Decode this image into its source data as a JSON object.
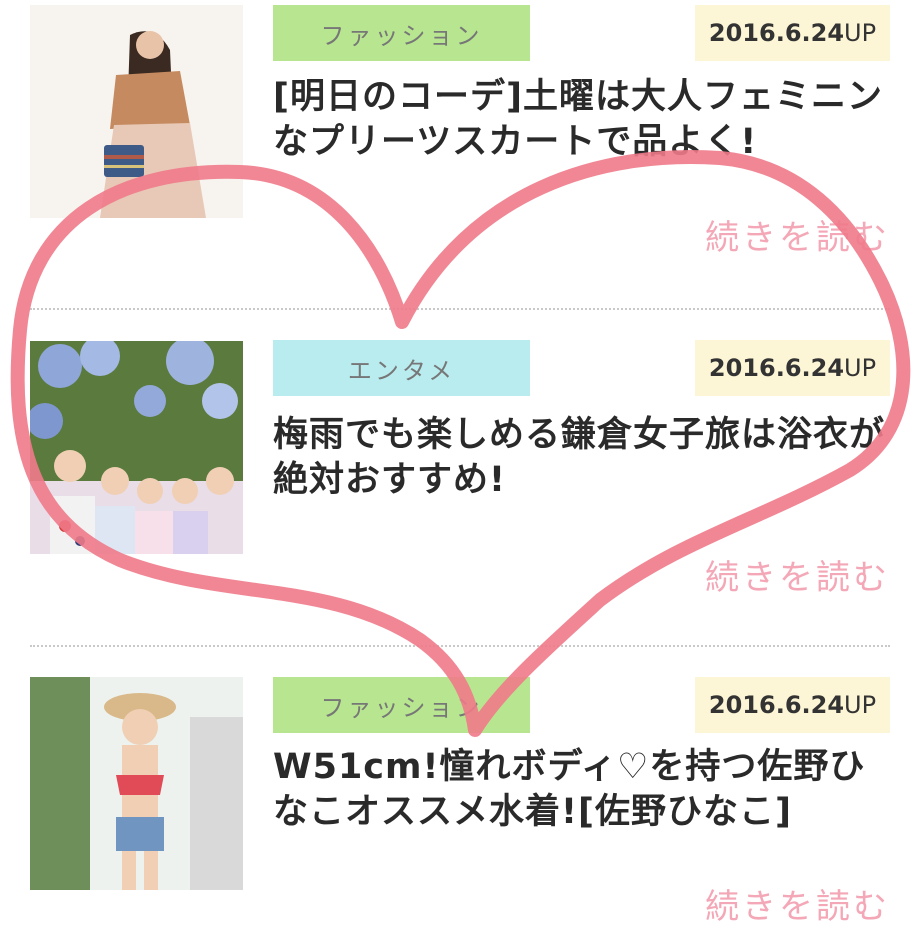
{
  "articles": [
    {
      "category": "ファッション",
      "category_color": "#b8e690",
      "date": "2016.6.24",
      "date_suffix": "UP",
      "title": "[明日のコーデ]土曜は大人フェミニンなプリーツスカートで品よく!",
      "read_more": "続きを読む"
    },
    {
      "category": "エンタメ",
      "category_color": "#b8ecef",
      "date": "2016.6.24",
      "date_suffix": "UP",
      "title": "梅雨でも楽しめる鎌倉女子旅は浴衣が絶対おすすめ!",
      "read_more": "続きを読む"
    },
    {
      "category": "ファッション",
      "category_color": "#b8e690",
      "date": "2016.6.24",
      "date_suffix": "UP",
      "title": "W51cm!憧れボディ♡を持つ佐野ひなこオススメ水着![佐野ひなこ]",
      "read_more": "続きを読む"
    }
  ],
  "overlay": {
    "heart_color": "#f07a8a"
  }
}
